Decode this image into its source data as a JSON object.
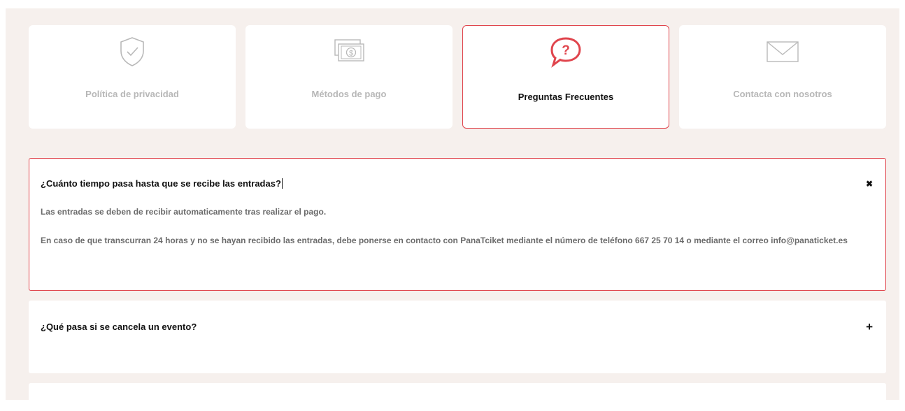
{
  "cards": [
    {
      "label": "Política de privacidad",
      "icon": "shield-check-icon"
    },
    {
      "label": "Métodos de pago",
      "icon": "money-bills-icon"
    },
    {
      "label": "Preguntas Frecuentes",
      "icon": "question-bubble-icon"
    },
    {
      "label": "Contacta con nosotros",
      "icon": "envelope-icon"
    }
  ],
  "faq": [
    {
      "question": "¿Cuánto tiempo pasa hasta que se recibe las entradas?",
      "toggle": "✖",
      "answer1": "Las entradas se deben de recibir automaticamente tras realizar el pago.",
      "answer2": "En caso de que transcurran 24 horas y no se hayan recibido las entradas, debe ponerse en contacto con PanaTciket mediante el número de teléfono 667 25 70 14 o mediante el correo info@panaticket.es"
    },
    {
      "question": "¿Qué pasa si se cancela un evento?",
      "toggle": "+"
    }
  ],
  "colors": {
    "accent": "#e0454d",
    "background": "#f6f0ed",
    "muted_icon": "#b9b9b9"
  }
}
